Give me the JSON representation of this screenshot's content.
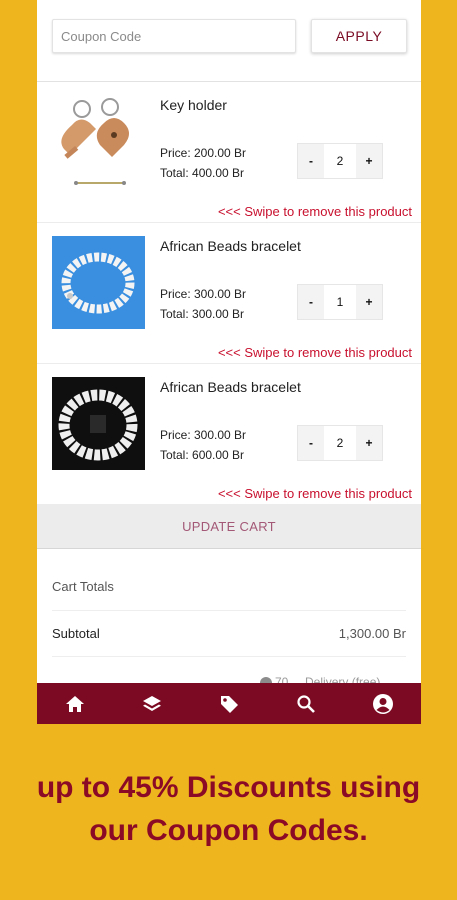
{
  "coupon": {
    "placeholder": "Coupon Code",
    "apply_label": "APPLY"
  },
  "products": [
    {
      "name": "Key holder",
      "price": "Price: 200.00 Br",
      "total": "Total: 400.00 Br",
      "qty": "2",
      "swipe": "<<< Swipe to remove this product",
      "minus": "-",
      "plus": "+"
    },
    {
      "name": "African Beads bracelet",
      "price": "Price: 300.00 Br",
      "total": "Total: 300.00 Br",
      "qty": "1",
      "swipe": "<<< Swipe to remove this product",
      "minus": "-",
      "plus": "+"
    },
    {
      "name": "African Beads bracelet",
      "price": "Price: 300.00 Br",
      "total": "Total: 600.00 Br",
      "qty": "2",
      "swipe": "<<< Swipe to remove this product",
      "minus": "-",
      "plus": "+"
    }
  ],
  "update_cart_label": "UPDATE CART",
  "cart_totals": {
    "title": "Cart Totals",
    "subtotal_label": "Subtotal",
    "subtotal_value": "1,300.00 Br",
    "cutoff_text": "70 ... Delivery (free)"
  },
  "nav": [
    {
      "icon": "home-icon"
    },
    {
      "icon": "layers-icon"
    },
    {
      "icon": "tag-icon"
    },
    {
      "icon": "search-icon"
    },
    {
      "icon": "account-icon"
    }
  ],
  "promo": {
    "line1": "up to 45% Discounts using",
    "line2": "our Coupon Codes."
  },
  "colors": {
    "background": "#EFB51E",
    "brand": "#7B0A22",
    "accent_red": "#C8102E"
  }
}
